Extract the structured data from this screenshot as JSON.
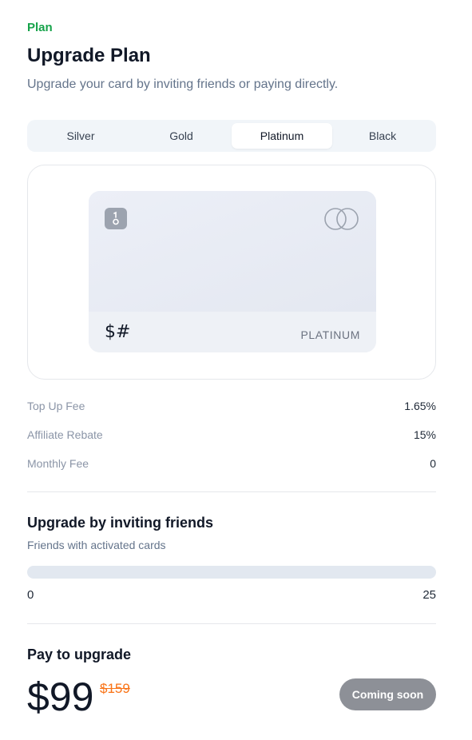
{
  "header": {
    "eyebrow": "Plan",
    "title": "Upgrade Plan",
    "subtitle": "Upgrade your card by inviting friends or paying directly."
  },
  "tabs": [
    {
      "label": "Silver"
    },
    {
      "label": "Gold"
    },
    {
      "label": "Platinum",
      "active": true
    },
    {
      "label": "Black"
    }
  ],
  "card": {
    "brand_mark": "$#",
    "tier": "PLATINUM",
    "chip_icon": "chip-icon",
    "network_icon": "mastercard-rings-icon"
  },
  "fees": [
    {
      "label": "Top Up Fee",
      "value": "1.65%"
    },
    {
      "label": "Affiliate Rebate",
      "value": "15%"
    },
    {
      "label": "Monthly Fee",
      "value": "0"
    }
  ],
  "invite": {
    "title": "Upgrade by inviting friends",
    "subtitle": "Friends with activated cards",
    "progress_fraction": 0,
    "min": "0",
    "max": "25"
  },
  "pay": {
    "title": "Pay to upgrade",
    "price": "$99",
    "old_price": "$159",
    "button_label": "Coming soon"
  },
  "colors": {
    "accent": "#16a34a",
    "strike": "#f97316",
    "button": "#8d9097"
  }
}
